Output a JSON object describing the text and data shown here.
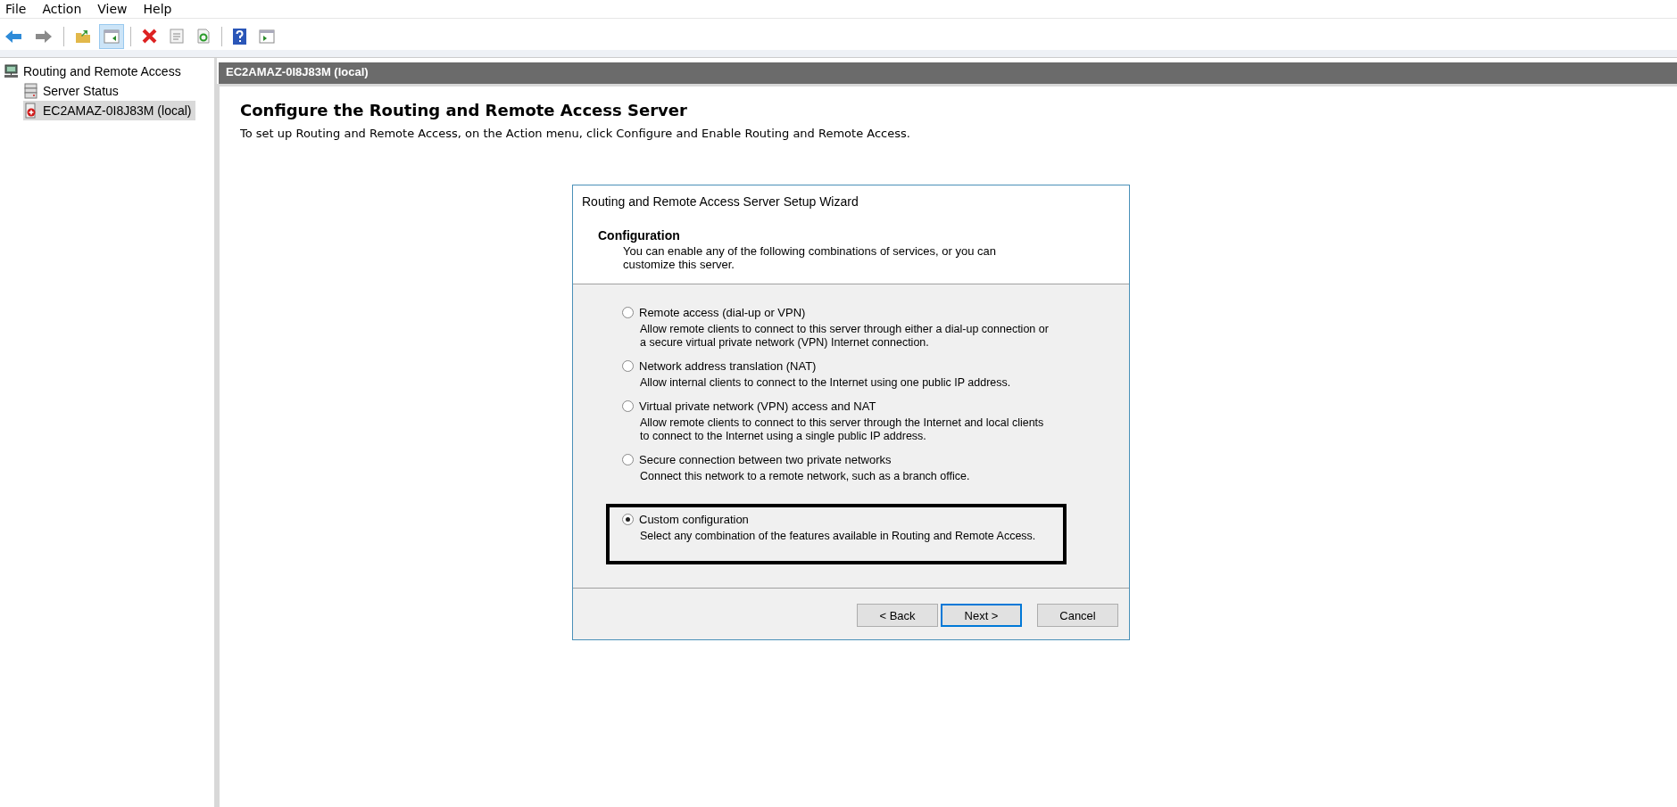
{
  "menu_bar": [
    "File",
    "Action",
    "View",
    "Help"
  ],
  "toolbar": [
    {
      "kind": "back",
      "pressed": false
    },
    {
      "kind": "forward",
      "pressed": false
    },
    {
      "kind": "up",
      "pressed": false
    },
    {
      "kind": "pane",
      "pressed": true
    },
    {
      "kind": "delete",
      "pressed": false
    },
    {
      "kind": "properties",
      "pressed": false
    },
    {
      "kind": "refresh",
      "pressed": false
    },
    {
      "kind": "help",
      "pressed": false
    },
    {
      "kind": "showpane",
      "pressed": false
    }
  ],
  "tree": {
    "label": "Routing and Remote Access",
    "selected": false,
    "children": [
      {
        "label": "Server Status",
        "kind": "status",
        "selected": false
      },
      {
        "label": "EC2AMAZ-0I8J83M (local)",
        "kind": "server",
        "selected": true
      }
    ]
  },
  "header_bar": "EC2AMAZ-0I8J83M (local)",
  "page": {
    "title": "Configure the Routing and Remote Access Server",
    "description": "To set up Routing and Remote Access, on the Action menu, click Configure and Enable Routing and Remote Access."
  },
  "wizard": {
    "title": "Routing and Remote Access Server Setup Wizard",
    "heading": "Configuration",
    "subheading": "You can enable any of the following combinations of services, or you can customize this server.",
    "options": [
      {
        "label": "Remote access (dial-up or VPN)",
        "description": "Allow remote clients to connect to this server through either a dial-up connection or a secure virtual private network (VPN) Internet connection.",
        "selected": false,
        "highlighted": false
      },
      {
        "label": "Network address translation (NAT)",
        "description": "Allow internal clients to connect to the Internet using one public IP address.",
        "selected": false,
        "highlighted": false
      },
      {
        "label": "Virtual private network (VPN) access and NAT",
        "description": "Allow remote clients to connect to this server through the Internet and local clients to connect to the Internet using a single public IP address.",
        "selected": false,
        "highlighted": false
      },
      {
        "label": "Secure connection between two private networks",
        "description": "Connect this network to a remote network, such as a branch office.",
        "selected": false,
        "highlighted": false
      },
      {
        "label": "Custom configuration",
        "description": "Select any combination of the features available in Routing and Remote Access.",
        "selected": true,
        "highlighted": true
      }
    ],
    "buttons": [
      {
        "label": "< Back",
        "default": false
      },
      {
        "label": "Next >",
        "default": true
      },
      {
        "label": "Cancel",
        "default": false
      }
    ]
  }
}
